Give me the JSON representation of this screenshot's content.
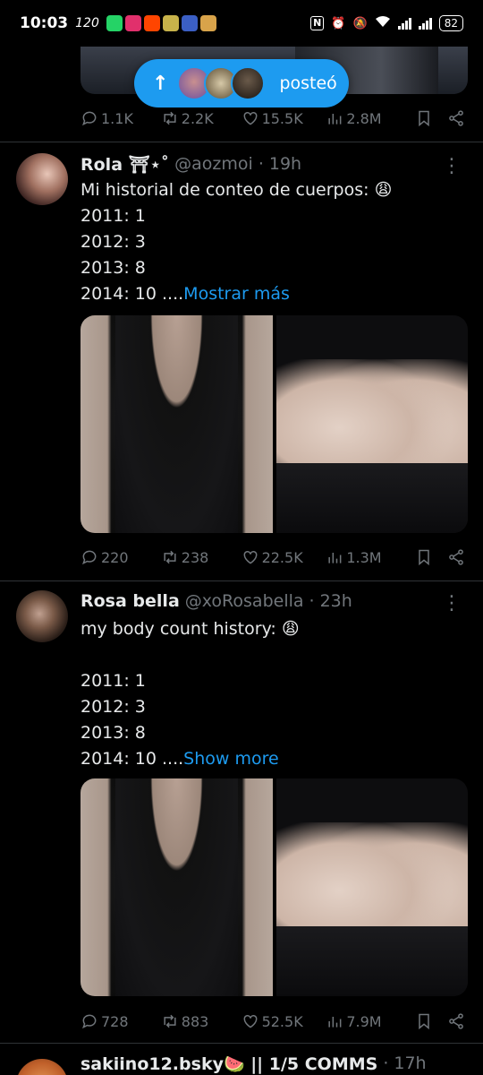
{
  "status_bar": {
    "time": "10:03",
    "speed": "120",
    "battery": "82",
    "nfc_label": "N"
  },
  "posted_pill": {
    "label": "posteó",
    "arrow": "↑"
  },
  "prev_post_actions": {
    "replies": "1.1K",
    "retweets": "2.2K",
    "likes": "15.5K",
    "views": "2.8M"
  },
  "tweets": [
    {
      "name": "Rola ⛩⋆˚",
      "handle": "@aozmoi",
      "dot": "·",
      "time": "19h",
      "text": "Mi historial de conteo de cuerpos: 😩\n2011: 1\n2012: 3\n2013: 8\n2014: 10 ....",
      "show_more": "Mostrar más",
      "replies": "220",
      "retweets": "238",
      "likes": "22.5K",
      "views": "1.3M"
    },
    {
      "name": "Rosa bella",
      "handle": "@xoRosabella",
      "dot": "·",
      "time": "23h",
      "text": "my body count history: 😩\n\n2011: 1\n2012: 3\n2013: 8\n2014: 10 ....",
      "show_more": "Show more",
      "replies": "728",
      "retweets": "883",
      "likes": "52.5K",
      "views": "7.9M"
    }
  ],
  "next_tweet": {
    "name": "sakiino12.bsky🍉 || 1/5 COMMS",
    "dot": "·",
    "time": "17h"
  },
  "colors": {
    "accent": "#1d9bf0",
    "muted": "#71767b",
    "text": "#e7e9ea",
    "divider": "#2f3336"
  }
}
